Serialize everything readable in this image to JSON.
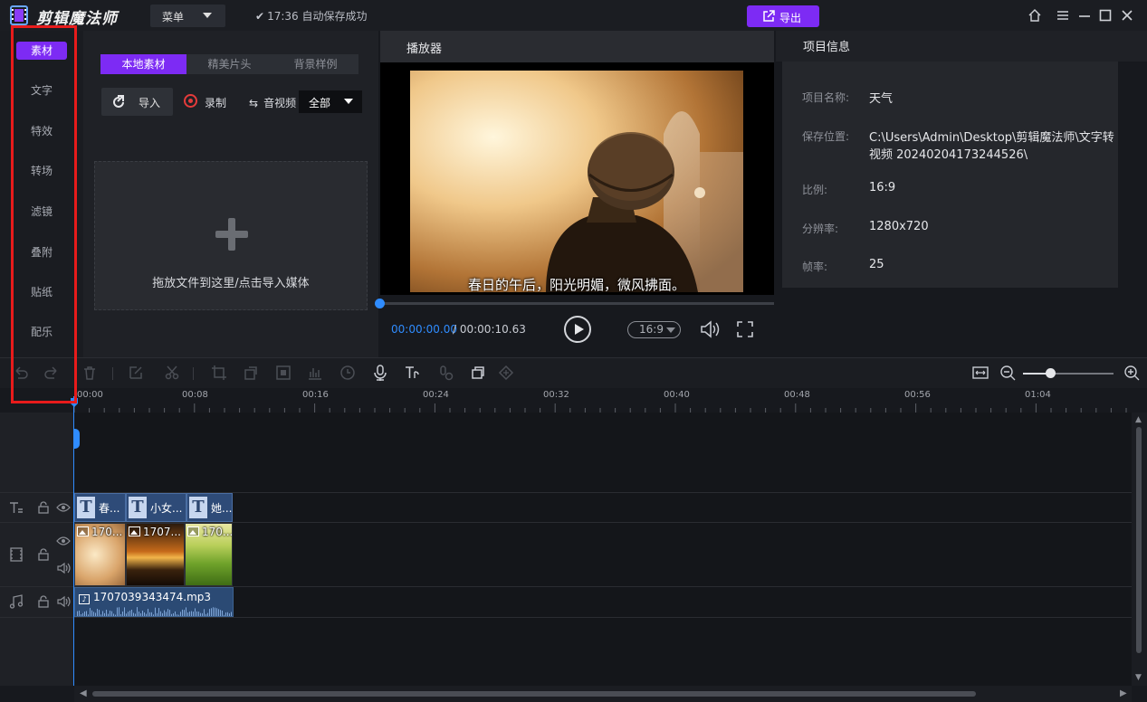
{
  "app": {
    "title": "剪辑魔法师",
    "menu_label": "菜单",
    "save_status": "17:36 自动保存成功",
    "export_label": "导出"
  },
  "left_nav": {
    "items": [
      {
        "label": "素材",
        "active": true
      },
      {
        "label": "文字"
      },
      {
        "label": "特效"
      },
      {
        "label": "转场"
      },
      {
        "label": "滤镜"
      },
      {
        "label": "叠附"
      },
      {
        "label": "贴纸"
      },
      {
        "label": "配乐"
      }
    ]
  },
  "media": {
    "tabs": [
      {
        "label": "本地素材",
        "active": true
      },
      {
        "label": "精美片头"
      },
      {
        "label": "背景样例"
      }
    ],
    "import_label": "导入",
    "record_label": "录制",
    "av_label": "音视频",
    "av_select": "全部",
    "dropzone_text": "拖放文件到这里/点击导入媒体"
  },
  "player": {
    "title": "播放器",
    "subtitle": "春日的午后，阳光明媚，微风拂面。",
    "time_current": "00:00:00.00",
    "time_total": "/ 00:00:10.63",
    "ratio": "16:9",
    "progress": 0
  },
  "project_info": {
    "title": "项目信息",
    "rows": [
      {
        "label": "项目名称:",
        "value": "天气"
      },
      {
        "label": "保存位置:",
        "value": "C:\\Users\\Admin\\Desktop\\剪辑魔法师\\文字转",
        "value2": "视频 20240204173244526\\"
      },
      {
        "label": "比例:",
        "value": "16:9"
      },
      {
        "label": "分辨率:",
        "value": "1280x720"
      },
      {
        "label": "帧率:",
        "value": "25"
      }
    ]
  },
  "timeline": {
    "ruler_labels": [
      "00:00",
      "00:08",
      "00:16",
      "00:24",
      "00:32",
      "00:40",
      "00:48",
      "00:56",
      "01:04"
    ],
    "zoom_level": 0.3,
    "text_clips": [
      "春...",
      "小女...",
      "她..."
    ],
    "video_clips": [
      "170...",
      "1707...",
      "170..."
    ],
    "audio_clip": "1707039343474.mp3"
  },
  "colors": {
    "accent": "#7d2bf4",
    "playhead": "#2f8cff",
    "highlight_frame": "#e81b1b"
  }
}
